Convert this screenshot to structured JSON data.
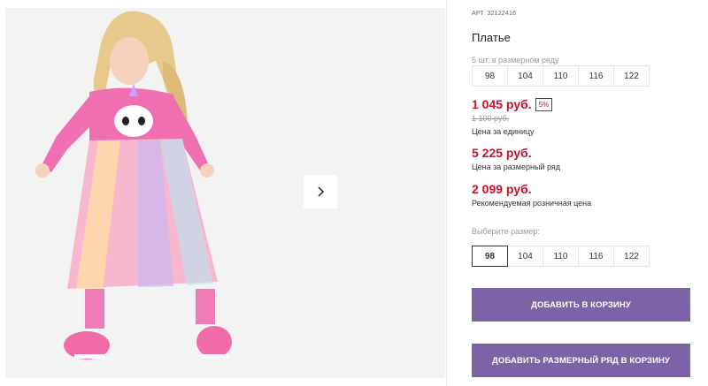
{
  "gallery": {
    "next_icon": "chevron-right-icon"
  },
  "product": {
    "article_label": "АРТ.",
    "article_value": "32122416",
    "title": "Платье"
  },
  "size_range": {
    "hint": "5 шт. в размерном ряду",
    "sizes": [
      "98",
      "104",
      "110",
      "116",
      "122"
    ]
  },
  "pricing": {
    "unit_price": "1 045 руб.",
    "discount_badge": "5%",
    "old_price": "1 100 руб.",
    "unit_caption": "Цена за единицу",
    "set_price": "5 225 руб.",
    "set_caption": "Цена за размерный ряд",
    "retail_price": "2 099 руб.",
    "retail_caption": "Рекомендуемая розничная цена"
  },
  "size_select": {
    "label": "Выберите размер:",
    "sizes": [
      "98",
      "104",
      "110",
      "116",
      "122"
    ],
    "selected": "98"
  },
  "actions": {
    "add_to_cart": "ДОБАВИТЬ В КОРЗИНУ",
    "add_set_to_cart": "ДОБАВИТЬ РАЗМЕРНЫЙ РЯД В КОРЗИНУ"
  },
  "colors": {
    "accent": "#7c63a6",
    "price": "#c8102e"
  }
}
